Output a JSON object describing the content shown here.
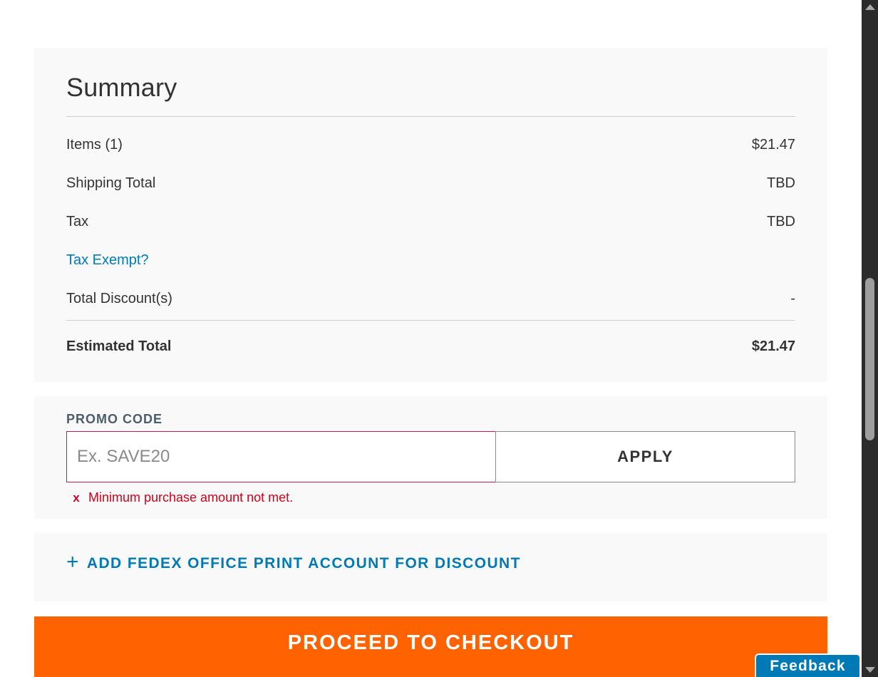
{
  "summary": {
    "title": "Summary",
    "rows": [
      {
        "label": "Items (1)",
        "value": "$21.47"
      },
      {
        "label": "Shipping Total",
        "value": "TBD"
      },
      {
        "label": "Tax",
        "value": "TBD"
      },
      {
        "label": "Total Discount(s)",
        "value": "-"
      }
    ],
    "tax_exempt_link": "Tax Exempt?",
    "estimated_total_label": "Estimated Total",
    "estimated_total_value": "$21.47"
  },
  "promo": {
    "label": "PROMO CODE",
    "placeholder": "Ex. SAVE20",
    "value": "",
    "apply_label": "APPLY",
    "error_icon": "x-icon",
    "error_icon_glyph": "x",
    "error_text": "Minimum purchase amount not met."
  },
  "account": {
    "plus_icon": "plus-icon",
    "plus_glyph": "+",
    "link_text": "ADD FEDEX OFFICE PRINT ACCOUNT FOR DISCOUNT"
  },
  "checkout": {
    "label": "PROCEED TO CHECKOUT"
  },
  "feedback": {
    "label": "Feedback"
  },
  "colors": {
    "accent_blue": "#007ab7",
    "checkout_orange": "#ff6200",
    "error_red": "#d0021b",
    "card_background": "#f9f9f9"
  }
}
